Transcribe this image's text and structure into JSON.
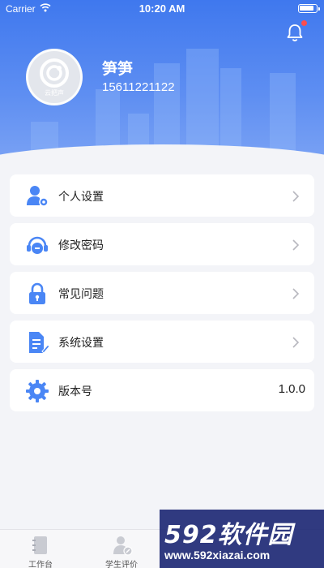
{
  "status_bar": {
    "carrier": "Carrier",
    "time": "10:20 AM"
  },
  "profile": {
    "name": "笋笋",
    "phone": "15611221122",
    "avatar_text": "云把声"
  },
  "menu": [
    {
      "label": "个人设置",
      "icon": "user-settings-icon",
      "has_chevron": true
    },
    {
      "label": "修改密码",
      "icon": "headset-icon",
      "has_chevron": true
    },
    {
      "label": "常见问题",
      "icon": "lock-icon",
      "has_chevron": true
    },
    {
      "label": "系统设置",
      "icon": "document-edit-icon",
      "has_chevron": true
    },
    {
      "label": "版本号",
      "icon": "gear-icon",
      "value": "1.0.0"
    }
  ],
  "tabbar": [
    {
      "label": "工作台",
      "icon": "notebook-icon"
    },
    {
      "label": "学生评价",
      "icon": "student-review-icon"
    }
  ],
  "watermark": {
    "brand": "592软件园",
    "url": "www.592xiazai.com"
  },
  "colors": {
    "primary": "#3f78ee",
    "icon_blue": "#4a86f5",
    "badge_red": "#ff4d4d",
    "background": "#f3f4f8"
  }
}
